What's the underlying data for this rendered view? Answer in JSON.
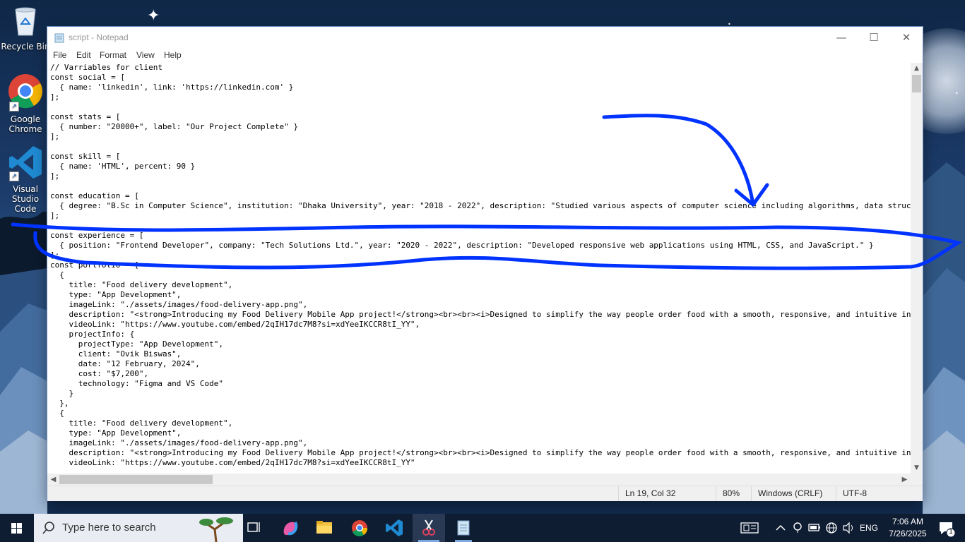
{
  "desktop": {
    "icons": [
      {
        "label": "Recycle Bin",
        "icon": "recycle-bin-icon"
      },
      {
        "label": "Google Chrome",
        "icon": "chrome-icon"
      },
      {
        "label": "Visual Studio Code",
        "icon": "vscode-icon"
      }
    ]
  },
  "window": {
    "title": "script - Notepad",
    "menu": [
      "File",
      "Edit",
      "Format",
      "View",
      "Help"
    ],
    "lines": [
      "// Varriables for client",
      "const social = [",
      "  { name: 'linkedin', link: 'https://linkedin.com' }",
      "];",
      "",
      "const stats = [",
      "  { number: \"20000+\", label: \"Our Project Complete\" }",
      "];",
      "",
      "const skill = [",
      "  { name: 'HTML', percent: 90 }",
      "];",
      "",
      "const education = [",
      "  { degree: \"B.Sc in Computer Science\", institution: \"Dhaka University\", year: \"2018 - 2022\", description: \"Studied various aspects of computer science including algorithms, data structures, and software engineering.\" }",
      "];",
      "",
      "const experience = [",
      "  { position: \"Frontend Developer\", company: \"Tech Solutions Ltd.\", year: \"2020 - 2022\", description: \"Developed responsive web applications using HTML, CSS, and JavaScript.\" }",
      "];",
      "const portfolio = [",
      "  {",
      "    title: \"Food delivery development\",",
      "    type: \"App Development\",",
      "    imageLink: \"./assets/images/food-delivery-app.png\",",
      "    description: \"<strong>Introducing my Food Delivery Mobile App project!</strong><br><br><i>Designed to simplify the way people order food with a smooth, responsive, and intuitive interface.</i>\",",
      "    videoLink: \"https://www.youtube.com/embed/2qIH17dc7M8?si=xdYeeIKCCR8tI_YY\",",
      "    projectInfo: {",
      "      projectType: \"App Development\",",
      "      client: \"Ovik Biswas\",",
      "      date: \"12 February, 2024\",",
      "      cost: \"$7,200\",",
      "      technology: \"Figma and VS Code\"",
      "    }",
      "  },",
      "  {",
      "    title: \"Food delivery development\",",
      "    type: \"App Development\",",
      "    imageLink: \"./assets/images/food-delivery-app.png\",",
      "    description: \"<strong>Introducing my Food Delivery Mobile App project!</strong><br><br><i>Designed to simplify the way people order food with a smooth, responsive, and intuitive interface.</i>\",",
      "    videoLink: \"https://www.youtube.com/embed/2qIH17dc7M8?si=xdYeeIKCCR8tI_YY\""
    ],
    "status": {
      "position": "Ln 19, Col 32",
      "zoom": "80%",
      "line_ending": "Windows (CRLF)",
      "encoding": "UTF-8"
    }
  },
  "annotation": {
    "color": "#0033ff"
  },
  "taskbar": {
    "search_placeholder": "Type here to search",
    "pinned": [
      "task-view-icon",
      "copilot-icon",
      "file-explorer-icon",
      "chrome-icon",
      "vscode-icon",
      "snipping-tool-icon",
      "notepad-icon"
    ],
    "language": "ENG",
    "time": "7:06 AM",
    "date": "7/26/2025",
    "notification_count": "1"
  }
}
